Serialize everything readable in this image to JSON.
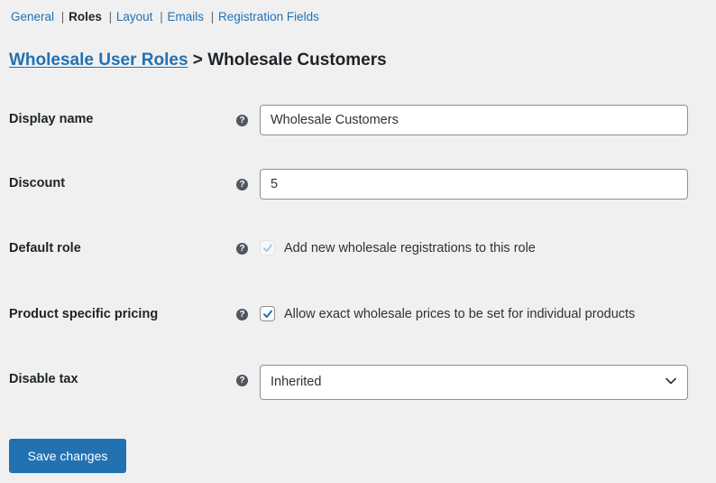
{
  "nav": {
    "items": [
      {
        "label": "General",
        "current": false
      },
      {
        "label": "Roles",
        "current": true
      },
      {
        "label": "Layout",
        "current": false
      },
      {
        "label": "Emails",
        "current": false
      },
      {
        "label": "Registration Fields",
        "current": false
      }
    ],
    "separator": "|"
  },
  "heading": {
    "link": "Wholesale User Roles",
    "separator": " > ",
    "current": "Wholesale Customers"
  },
  "fields": {
    "display_name": {
      "label": "Display name",
      "value": "Wholesale Customers",
      "help_icon": "question-circle"
    },
    "discount": {
      "label": "Discount",
      "value": "5",
      "help_icon": "question-circle"
    },
    "default_role": {
      "label": "Default role",
      "checkbox_label": "Add new wholesale registrations to this role",
      "checked": true,
      "disabled": true,
      "help_icon": "question-circle"
    },
    "product_specific_pricing": {
      "label": "Product specific pricing",
      "checkbox_label": "Allow exact wholesale prices to be set for individual products",
      "checked": true,
      "disabled": false,
      "help_icon": "question-circle"
    },
    "disable_tax": {
      "label": "Disable tax",
      "selected": "Inherited",
      "help_icon": "question-circle"
    }
  },
  "save_button": {
    "label": "Save changes"
  },
  "colors": {
    "accent": "#2271b1",
    "background": "#f0f0f1",
    "text": "#1d2327"
  }
}
